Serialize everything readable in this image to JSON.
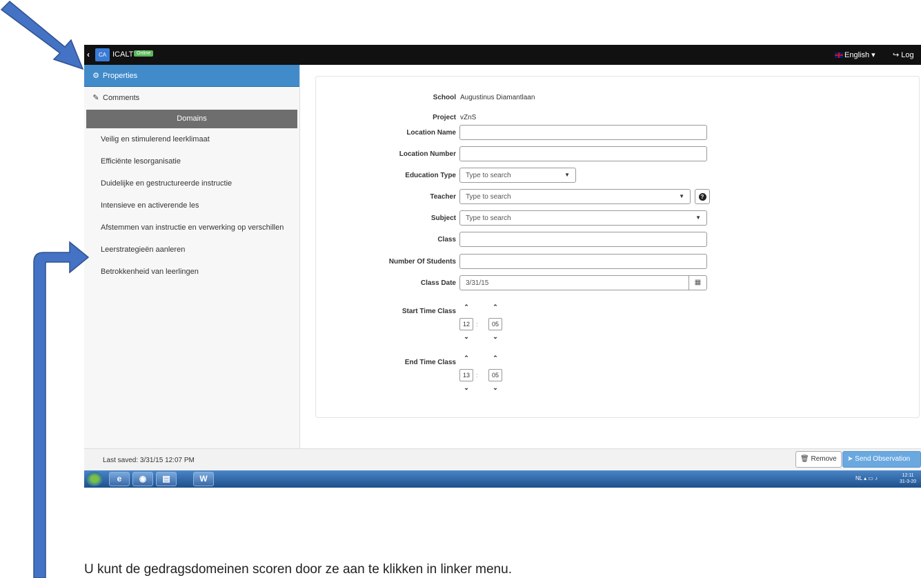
{
  "topbar": {
    "app_name": "ICALT",
    "status_badge": "Online",
    "language": "English",
    "logout_label": "Log"
  },
  "sidebar": {
    "properties_label": "Properties",
    "comments_label": "Comments",
    "domains_header": "Domains",
    "domains": [
      "Veilig en stimulerend leerklimaat",
      "Efficiënte lesorganisatie",
      "Duidelijke en gestructureerde instructie",
      "Intensieve en activerende les",
      "Afstemmen van instructie en verwerking op verschillen",
      "Leerstrategieën aanleren",
      "Betrokkenheid van leerlingen"
    ]
  },
  "form": {
    "school_label": "School",
    "school_value": "Augustinus Diamantlaan",
    "project_label": "Project",
    "project_value": "vZnS",
    "location_name_label": "Location Name",
    "location_number_label": "Location Number",
    "education_type_label": "Education Type",
    "education_type_placeholder": "Type to search",
    "teacher_label": "Teacher",
    "teacher_placeholder": "Type to search",
    "subject_label": "Subject",
    "subject_placeholder": "Type to search",
    "class_label": "Class",
    "students_label": "Number Of Students",
    "class_date_label": "Class Date",
    "class_date_value": "3/31/15",
    "start_time_label": "Start Time Class",
    "start_hour": "12",
    "start_minute": "05",
    "end_time_label": "End Time Class",
    "end_hour": "13",
    "end_minute": "05"
  },
  "footer": {
    "last_saved": "Last saved: 3/31/15 12:07 PM",
    "remove_label": "Remove",
    "send_label": "Send Observation"
  },
  "taskbar": {
    "tray_lang": "NL",
    "clock_time": "12:11",
    "clock_date": "31-3-20"
  },
  "caption": "U kunt de gedragsdomeinen scoren door ze aan te klikken in linker menu.",
  "colors": {
    "arrow": "#4472c4",
    "active_nav": "#428bca",
    "domains_header": "#6e6e6e",
    "online_badge": "#5cb85c"
  }
}
